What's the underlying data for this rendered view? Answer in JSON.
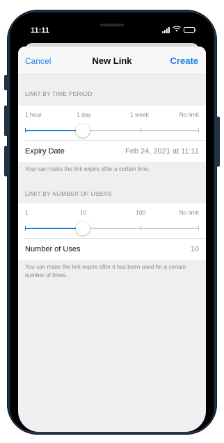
{
  "status_bar": {
    "time": "11:11"
  },
  "nav": {
    "cancel": "Cancel",
    "title": "New Link",
    "create": "Create"
  },
  "time_section": {
    "header": "LIMIT BY TIME PERIOD",
    "stops": [
      "1 hour",
      "1 day",
      "1 week",
      "No limit"
    ],
    "slider_value": 1,
    "row_label": "Expiry Date",
    "row_value": "Feb 24, 2021 at 11:11",
    "footer": "Your can make the link expire after a certain time."
  },
  "users_section": {
    "header": "LIMIT BY NUMBER OF USERS",
    "stops": [
      "1",
      "10",
      "100",
      "No limit"
    ],
    "slider_value": 1,
    "row_label": "Number of Uses",
    "row_value": "10",
    "footer": "You can make the link expire after it has been used for a certain number of times."
  },
  "colors": {
    "accent": "#1a7ee0",
    "frame": "#1f3248",
    "background": "#efeff2"
  }
}
